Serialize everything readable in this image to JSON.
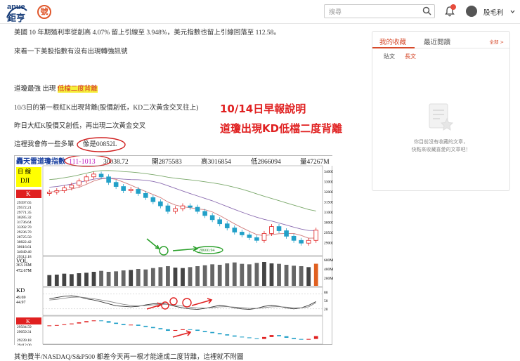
{
  "header": {
    "logo_top": "anue",
    "logo_bottom": "鉅亨",
    "logo_badge": "號",
    "search_placeholder": "搜尋",
    "username": "股毛利"
  },
  "article": {
    "line1": "美國 10 年期殖利率從創高 4.07% 留上引線至 3.948%，美元指數也留上引線回落至 112.58。",
    "line2": "來看一下美股指數有沒有出現轉強訊號",
    "line3_prefix": "道瓊最強 出現",
    "line3_highlight": "低檔二度背離",
    "line4": "10/3日的第一根紅K出現背離(股價創低，KD二次黃金交叉往上)",
    "line5": "昨日大紅K股價又創低，再出現二次黃金交叉",
    "line6_prefix": "這裡我會佈一些多單",
    "line6_circled": "像是00852L",
    "note1": "10/14日早報說明",
    "note2": "道瓊出現KD低檔二度背離",
    "bottom": "其他費半/NASDAQ/S&P500 都差今天再一根才能達成二度背離，這裡就不附圖"
  },
  "sidebar": {
    "tab_active": "我的收藏",
    "tab_inactive": "最近閱讀",
    "more": "全部 >",
    "subtab_post": "貼文",
    "subtab_article": "長文",
    "empty_line1": "你目前沒有收藏的文章，",
    "empty_line2": "快點來收藏喜愛的文章吧！"
  },
  "chart": {
    "header_title": "轟天雷道瓊指數",
    "header_date": "111-1013",
    "header_close": "30038.72",
    "header_open": "開2875583",
    "header_high": "高3016854",
    "header_low": "低2866094",
    "header_vol": "量47267M",
    "period_label": "日 線",
    "symbol": "DJI",
    "k_label": "K",
    "vol_label": "VOL",
    "kd_label": "KD",
    "k2_label": "K",
    "price_ticks": [
      "34000",
      "33000",
      "32000",
      "31500",
      "31000",
      "30000",
      "29500",
      "29000"
    ],
    "vol_ticks": [
      "600M",
      "400M",
      "200M"
    ],
    "kd_ticks": [
      "80",
      "50",
      "20"
    ],
    "left_values": [
      "29397.65",
      "29572.21",
      "29771.35",
      "30285.32",
      "31736.64",
      "33392.70",
      "29236.70",
      "28725.50",
      "30822.42",
      "30616.61",
      "34049.46",
      "29312.18"
    ],
    "vol_values": [
      "363.16M",
      "472.67M"
    ],
    "kd_values": [
      "49.69",
      "44.97"
    ],
    "k2_values": [
      "29584.59",
      "29059.31",
      "29239.18",
      "29412.00"
    ],
    "low_label": "28660.94",
    "chart_colors": {
      "up": "#e02020",
      "down": "#22a0c8",
      "ma1": "#d07a7a",
      "ma2": "#8a6bb0",
      "ma3": "#7aa86a",
      "annotation_red": "#e02020",
      "annotation_green": "#2aa02a"
    }
  },
  "chart_data": {
    "type": "candlestick",
    "title": "轟天雷道瓊指數",
    "close_series": [
      32800,
      32900,
      33100,
      33300,
      33600,
      33900,
      34100,
      33900,
      33500,
      33200,
      32900,
      33000,
      32700,
      32400,
      32100,
      31800,
      31400,
      31600,
      31800,
      31700,
      31400,
      31100,
      30800,
      30500,
      30200,
      29900,
      29700,
      29500,
      29300,
      29800,
      30300,
      30000,
      29600,
      29300,
      29100,
      29300,
      30038
    ],
    "volume_series": [
      230,
      240,
      260,
      250,
      270,
      280,
      300,
      320,
      300,
      310,
      330,
      340,
      360,
      350,
      380,
      400,
      420,
      390,
      380,
      400,
      420,
      440,
      460,
      450,
      480,
      500,
      470,
      460,
      490,
      510,
      480,
      470,
      450,
      430,
      420,
      400,
      472
    ],
    "k_series": [
      60,
      65,
      70,
      72,
      68,
      60,
      55,
      48,
      40,
      32,
      30,
      28,
      30,
      36,
      40,
      42,
      38,
      30,
      24,
      20,
      18,
      22,
      28,
      34,
      30,
      24,
      20,
      18,
      22,
      30,
      34,
      30,
      24,
      20,
      24,
      34,
      49
    ],
    "d_series": [
      55,
      58,
      62,
      66,
      67,
      64,
      60,
      55,
      50,
      44,
      38,
      34,
      32,
      33,
      36,
      38,
      38,
      35,
      31,
      27,
      24,
      23,
      25,
      28,
      29,
      27,
      25,
      22,
      22,
      25,
      28,
      29,
      27,
      24,
      24,
      28,
      45
    ]
  }
}
